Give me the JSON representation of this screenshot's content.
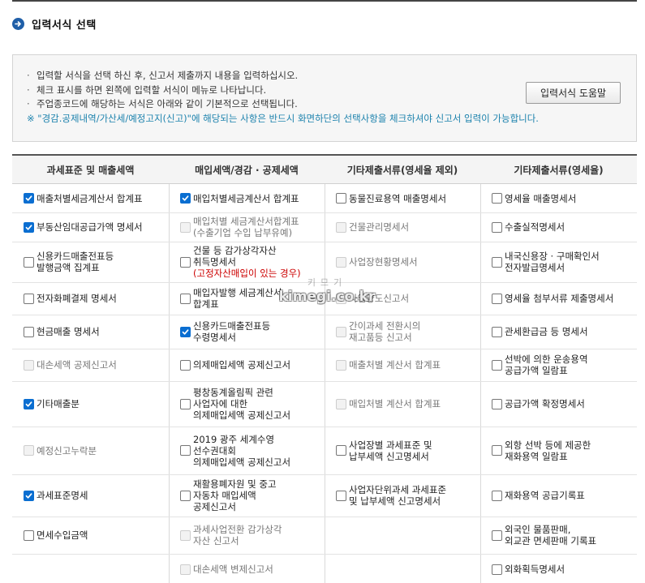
{
  "section": {
    "title": "입력서식 선택"
  },
  "info": {
    "lines": [
      "입력할 서식을 선택 하신 후, 신고서 제출까지 내용을 입력하십시오.",
      "체크 표시를 하면 왼쪽에 입력할 서식이 메뉴로 나타납니다.",
      "주업종코드에 해당하는 서식은 아래와 같이 기본적으로 선택됩니다."
    ],
    "note": "※ \"경감.공제내역/가산세/예정고지(신고)\"에 해당되는 사항은 반드시 화면하단의 선택사항을 체크하셔야 신고서 입력이 가능합니다.",
    "help_button": "입력서식 도움말"
  },
  "columns": [
    {
      "header": "과세표준 및 매출세액",
      "items": [
        {
          "label": "매출처별세금계산서 합계표",
          "state": "checked"
        },
        {
          "label": "부동산임대공급가액 명세서",
          "state": "checked"
        },
        {
          "label": "신용카드매출전표등\n발행금액 집계표",
          "state": "unchecked"
        },
        {
          "label": "전자화폐결제 명세서",
          "state": "unchecked"
        },
        {
          "label": "현금매출 명세서",
          "state": "unchecked"
        },
        {
          "label": "대손세액 공제신고서",
          "state": "disabled"
        },
        {
          "label": "기타매출분",
          "state": "checked"
        },
        {
          "label": "예정신고누락분",
          "state": "disabled"
        },
        {
          "label": "과세표준명세",
          "state": "checked"
        },
        {
          "label": "면세수입금액",
          "state": "unchecked"
        }
      ]
    },
    {
      "header": "매입세액/경감 · 공제세액",
      "items": [
        {
          "label": "매입처별세금계산서 합계표",
          "state": "checked"
        },
        {
          "label": "매입처별 세금계산서합계표\n(수출기업 수입 납부유예)",
          "state": "disabled"
        },
        {
          "label": "건물 등 감가상각자산\n취득명세서",
          "sub": "(고정자산매입이 있는 경우)",
          "state": "unchecked"
        },
        {
          "label": "매입자발행 세금계산서\n합계표",
          "state": "unchecked"
        },
        {
          "label": "신용카드매출전표등\n수령명세서",
          "state": "checked"
        },
        {
          "label": "의제매입세액 공제신고서",
          "state": "unchecked"
        },
        {
          "label": "평창동계올림픽 관련\n사업자에 대한\n의제매입세액 공제신고서",
          "state": "unchecked"
        },
        {
          "label": "2019 광주 세계수영\n선수권대회\n의제매입세액 공제신고서",
          "state": "unchecked"
        },
        {
          "label": "재활용폐자원 및 중고\n자동차 매입세액\n공제신고서",
          "state": "unchecked"
        },
        {
          "label": "과세사업전환 감가상각\n자산 신고서",
          "state": "disabled"
        },
        {
          "label": "대손세액 변제신고서",
          "state": "disabled"
        }
      ]
    },
    {
      "header": "기타제출서류(영세율 제외)",
      "items": [
        {
          "label": "동물진료용역 매출명세서",
          "state": "unchecked"
        },
        {
          "label": "건물관리명세서",
          "state": "disabled"
        },
        {
          "label": "사업장현황명세서",
          "state": "disabled"
        },
        {
          "label": "사업양도신고서",
          "state": "disabled"
        },
        {
          "label": "간이과세 전환시의\n재고품등 신고서",
          "state": "disabled"
        },
        {
          "label": "매출처별 계산서 합계표",
          "state": "disabled"
        },
        {
          "label": "매입처별 계산서 합계표",
          "state": "disabled"
        },
        {
          "label": "사업장별 과세표준 및\n납부세액 신고명세서",
          "state": "unchecked"
        },
        {
          "label": "사업자단위과세 과세표준\n및 납부세액 신고명세서",
          "state": "unchecked"
        }
      ]
    },
    {
      "header": "기타제출서류(영세율)",
      "items": [
        {
          "label": "영세율 매출명세서",
          "state": "unchecked"
        },
        {
          "label": "수출실적명세서",
          "state": "unchecked"
        },
        {
          "label": "내국신용장 · 구매확인서\n전자발급명세서",
          "state": "unchecked"
        },
        {
          "label": "영세율 첨부서류 제출명세서",
          "state": "unchecked"
        },
        {
          "label": "관세환급금 등 명세서",
          "state": "unchecked"
        },
        {
          "label": "선박에 의한 운송용역\n공급가액 일람표",
          "state": "unchecked"
        },
        {
          "label": "공급가액 확정명세서",
          "state": "unchecked"
        },
        {
          "label": "외항 선박 등에 제공한\n재화용역 일람표",
          "state": "unchecked"
        },
        {
          "label": "재화용역 공급기록표",
          "state": "unchecked"
        },
        {
          "label": "외국인 물품판매,\n외교관 면세판매 기록표",
          "state": "unchecked"
        },
        {
          "label": "외화획득명세서",
          "state": "unchecked"
        }
      ]
    }
  ],
  "watermark": {
    "top": "키므기",
    "main": "kimegi.co.kr"
  },
  "colors": {
    "accent": "#0a6ed1",
    "title_icon": "#1f5fa8",
    "note": "#1c82ad",
    "warning": "#cc0000"
  }
}
